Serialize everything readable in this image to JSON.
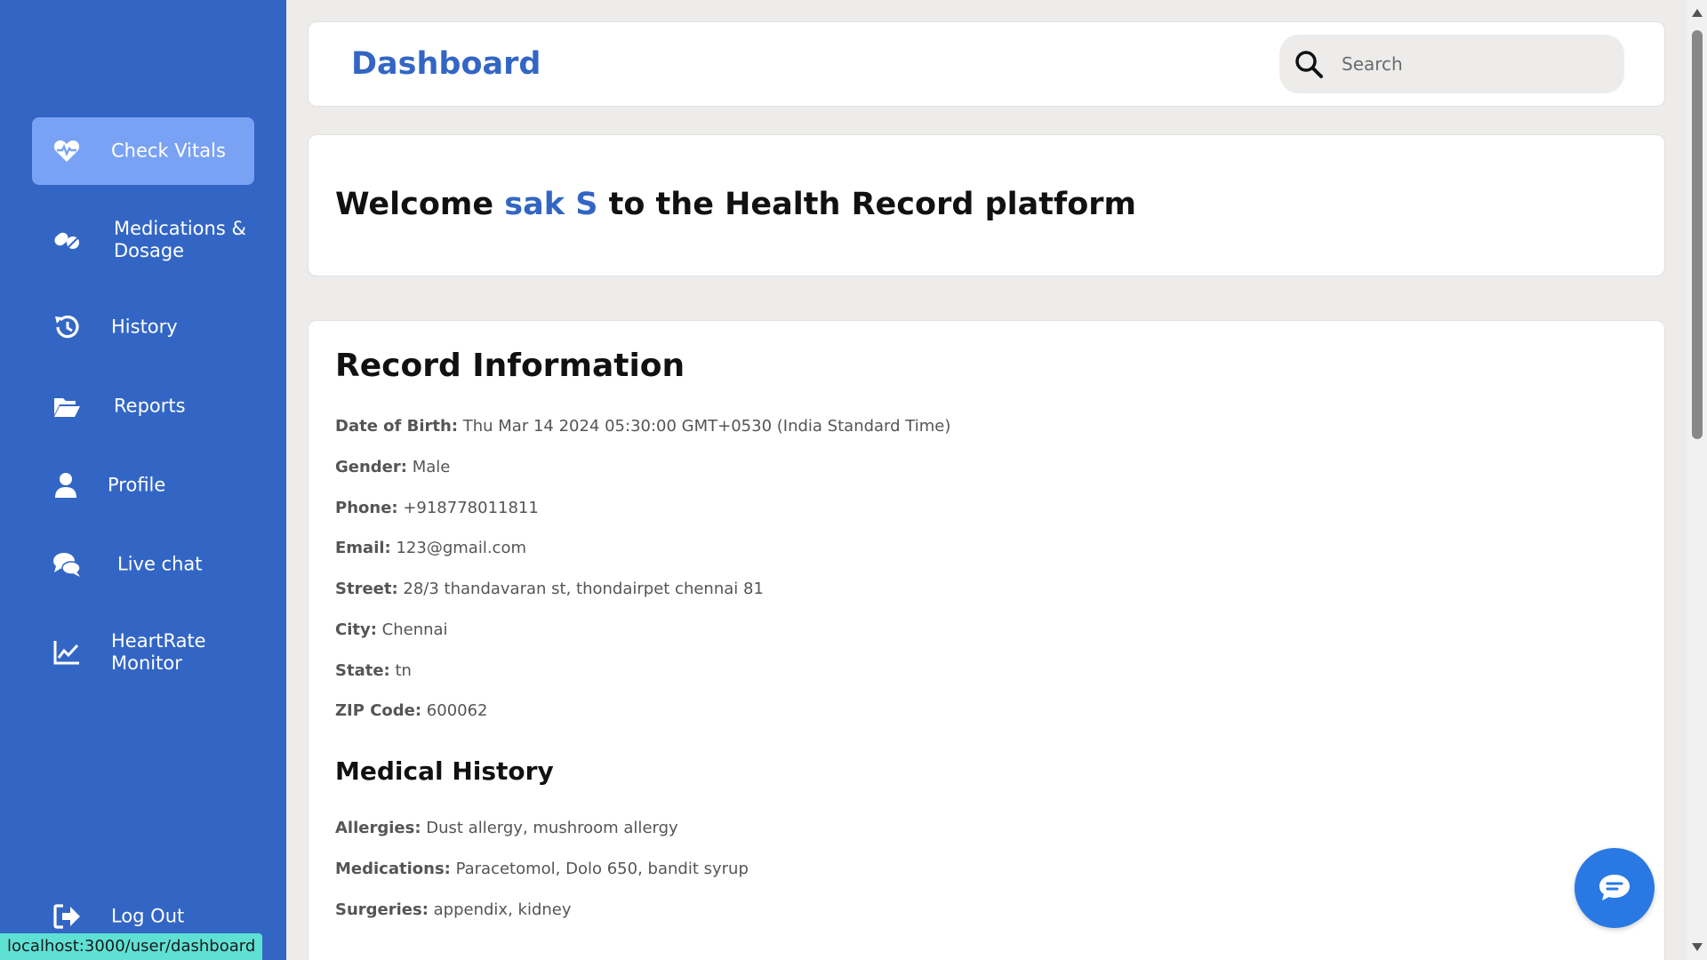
{
  "sidebar": {
    "items": [
      {
        "label": "Check Vitals",
        "icon": "heart-pulse-icon",
        "active": true
      },
      {
        "label": "Medications & Dosage",
        "icon": "pills-icon"
      },
      {
        "label": "History",
        "icon": "history-icon"
      },
      {
        "label": "Reports",
        "icon": "folder-open-icon"
      },
      {
        "label": "Profile",
        "icon": "user-icon"
      },
      {
        "label": "Live chat",
        "icon": "comments-icon"
      },
      {
        "label": "HeartRate Monitor",
        "icon": "chart-line-icon"
      }
    ],
    "logout_label": "Log Out"
  },
  "status_url": "localhost:3000/user/dashboard",
  "header": {
    "title": "Dashboard",
    "search_placeholder": "Search"
  },
  "welcome": {
    "prefix": "Welcome ",
    "name": "sak S",
    "suffix": " to the Health Record platform"
  },
  "record": {
    "title": "Record Information",
    "fields": [
      {
        "label": "Date of Birth:",
        "value": " Thu Mar 14 2024 05:30:00 GMT+0530 (India Standard Time)"
      },
      {
        "label": "Gender:",
        "value": " Male"
      },
      {
        "label": "Phone:",
        "value": " +918778011811"
      },
      {
        "label": "Email:",
        "value": " 123@gmail.com"
      },
      {
        "label": "Street:",
        "value": " 28/3 thandavaran st, thondairpet chennai 81"
      },
      {
        "label": "City:",
        "value": " Chennai"
      },
      {
        "label": "State:",
        "value": " tn"
      },
      {
        "label": "ZIP Code:",
        "value": " 600062"
      }
    ]
  },
  "medical_history": {
    "title": "Medical History",
    "fields": [
      {
        "label": "Allergies:",
        "value": " Dust allergy, mushroom allergy"
      },
      {
        "label": "Medications:",
        "value": " Paracetomol, Dolo 650, bandit syrup"
      },
      {
        "label": "Surgeries:",
        "value": " appendix, kidney"
      }
    ]
  },
  "colors": {
    "sidebar_bg": "#3366c4",
    "active_item_bg": "#7aa2f4",
    "accent": "#3366c4",
    "chat_fab": "#2a78e4"
  }
}
